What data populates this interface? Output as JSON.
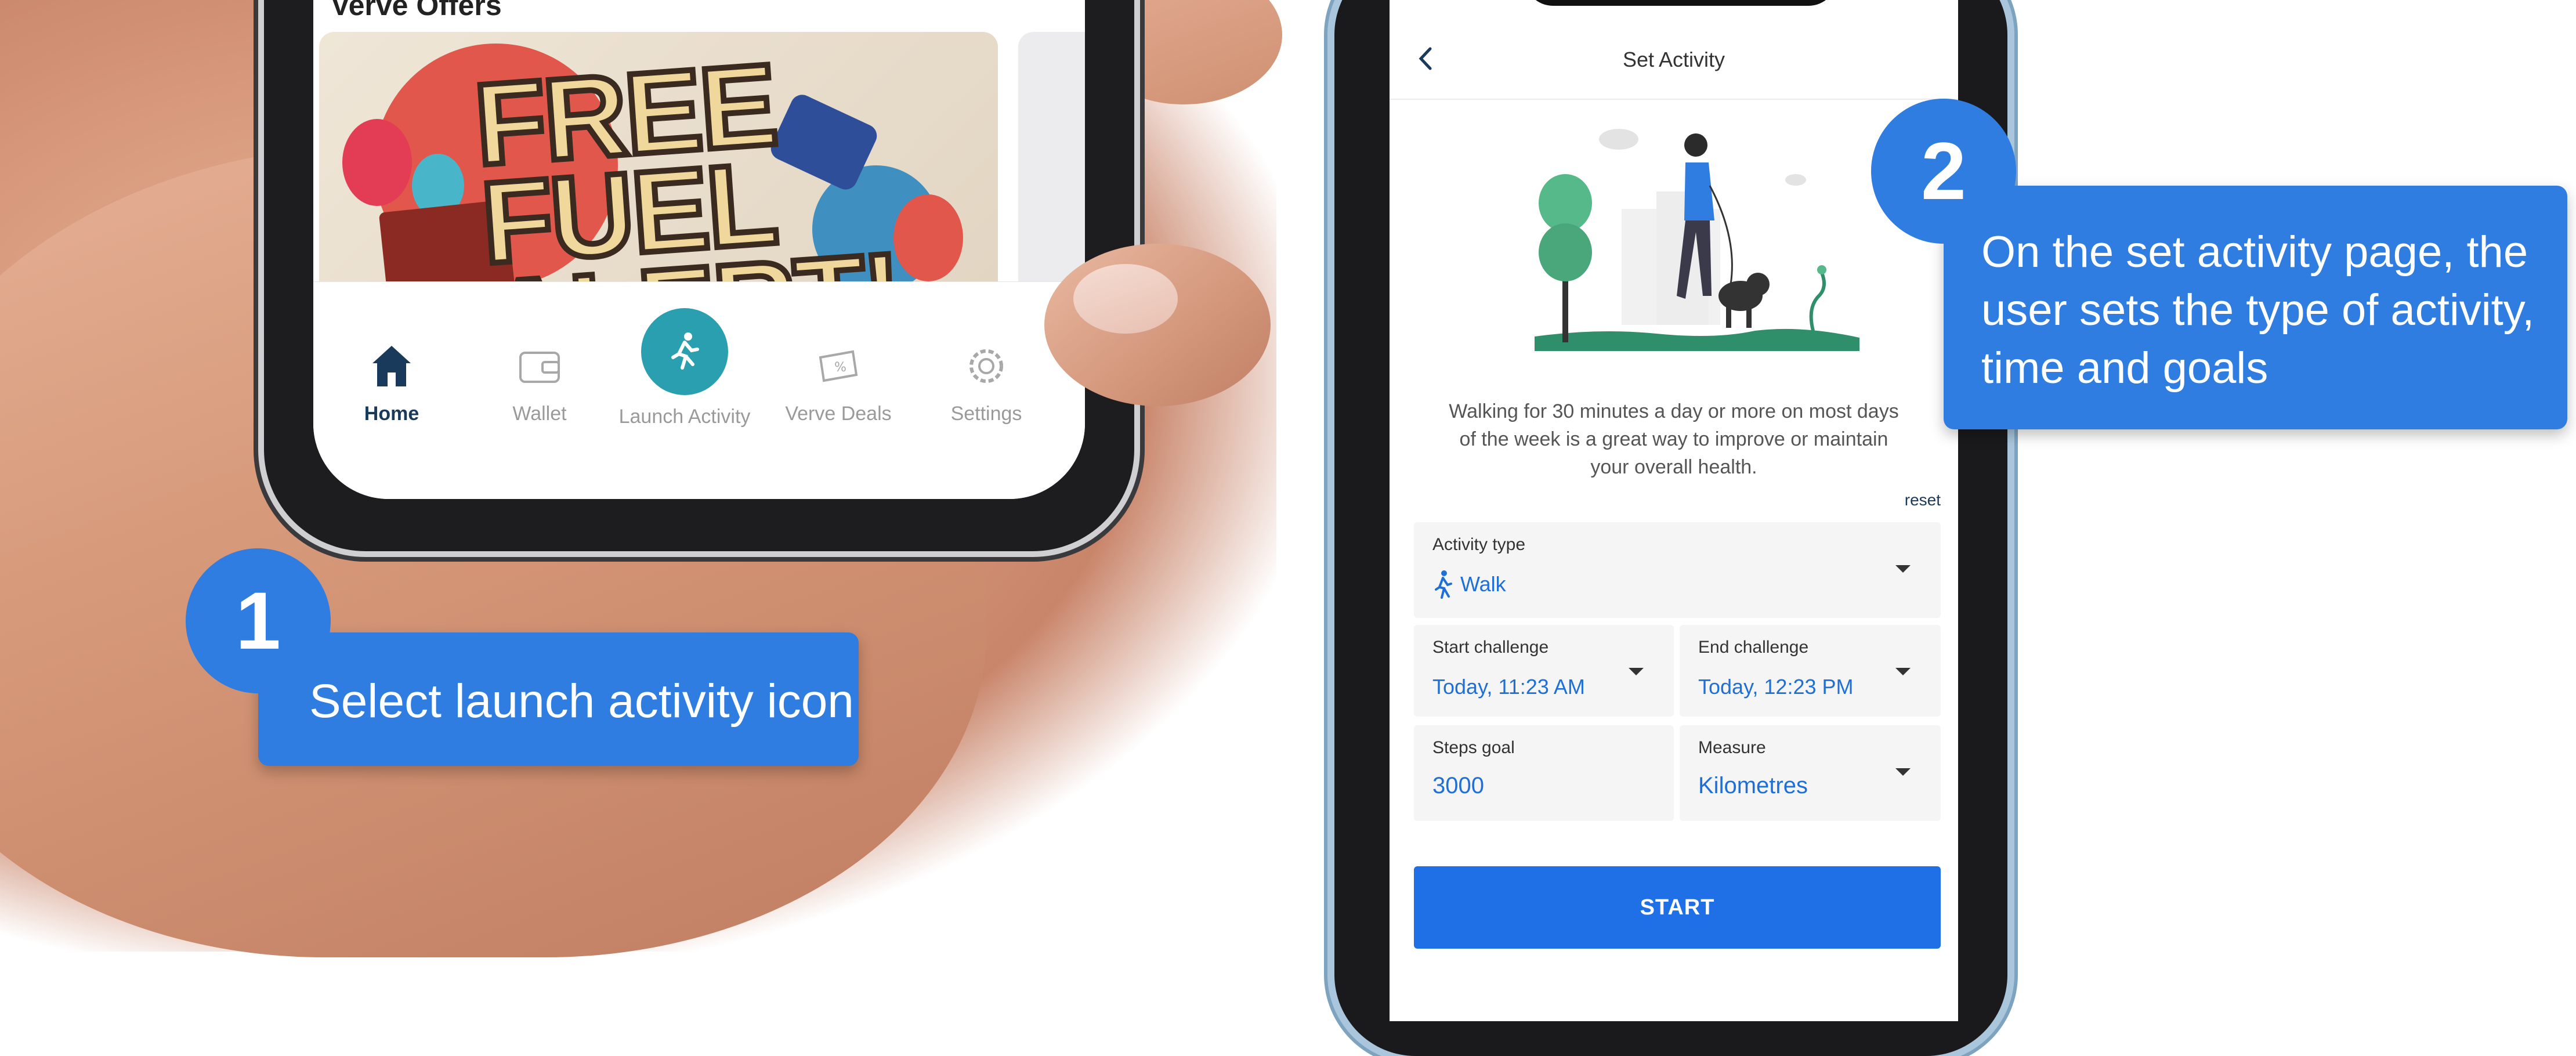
{
  "step1": {
    "badge": "1",
    "callout": "Select launch activity icon"
  },
  "phone1": {
    "section_title": "Verve Offers",
    "offer_text": "FREE FUEL ALERT!",
    "tabs": [
      {
        "label": "Home",
        "icon": "home-icon"
      },
      {
        "label": "Wallet",
        "icon": "wallet-icon"
      },
      {
        "label": "Launch Activity",
        "icon": "running-person-icon"
      },
      {
        "label": "Verve Deals",
        "icon": "ticket-discount-icon"
      },
      {
        "label": "Settings",
        "icon": "gear-icon"
      }
    ],
    "active_tab": "Home"
  },
  "step2": {
    "badge": "2",
    "callout": "On the set activity page, the user sets the type of activity, time and goals"
  },
  "set_activity": {
    "title": "Set Activity",
    "description": "Walking for 30 minutes a day or more on most days of the week is a great way to improve or maintain your overall health.",
    "reset_label": "reset",
    "activity_type": {
      "label": "Activity type",
      "value": "Walk"
    },
    "start_challenge": {
      "label": "Start challenge",
      "value": "Today, 11:23 AM"
    },
    "end_challenge": {
      "label": "End challenge",
      "value": "Today, 12:23 PM"
    },
    "steps_goal": {
      "label": "Steps goal",
      "value": "3000"
    },
    "measure": {
      "label": "Measure",
      "value": "Kilometres"
    },
    "start_button": "START"
  },
  "colors": {
    "accent_blue": "#2f7de1",
    "button_blue": "#1f6fe6",
    "launch_teal": "#2a9fb0",
    "nav_dark": "#1a3a5c"
  }
}
